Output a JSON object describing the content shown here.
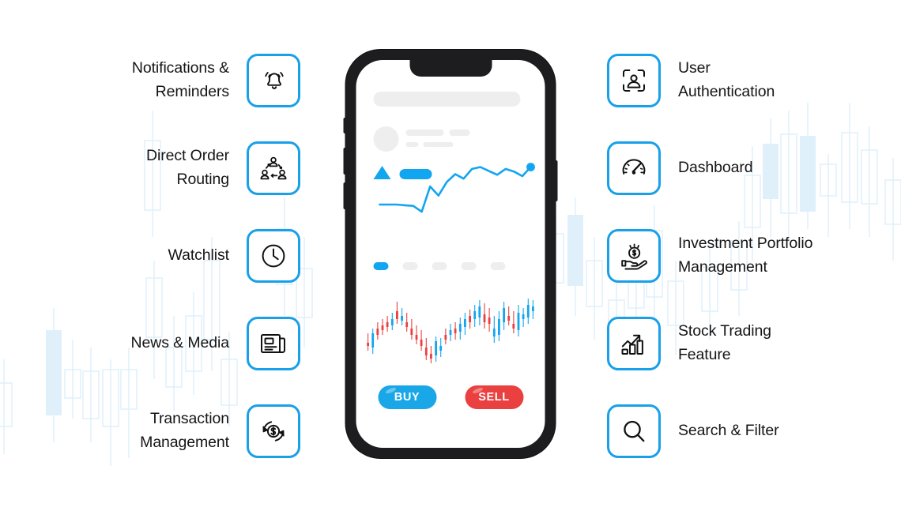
{
  "page": {
    "title": "Stock Trading App Features",
    "accent_color": "#18a0e8",
    "phone_accent": "#12a5f0",
    "buy_color": "#1aa7e8",
    "sell_color": "#ea4040",
    "background_color": "#ffffff",
    "watermark_color": "#dff0fb"
  },
  "features_left": [
    {
      "label": "Notifications &\nReminders",
      "icon": "bell-icon"
    },
    {
      "label": "Direct Order\nRouting",
      "icon": "order-routing-icon"
    },
    {
      "label": "Watchlist",
      "icon": "clock-icon"
    },
    {
      "label": "News & Media",
      "icon": "newspaper-icon"
    },
    {
      "label": "Transaction\nManagement",
      "icon": "transaction-refresh-dollar-icon"
    }
  ],
  "features_right": [
    {
      "label": "User\nAuthentication",
      "icon": "face-authentication-icon"
    },
    {
      "label": "Dashboard",
      "icon": "speedometer-icon"
    },
    {
      "label": "Investment Portfolio\nManagement",
      "icon": "hand-holding-dollar-icon"
    },
    {
      "label": "Stock Trading\nFeature",
      "icon": "bar-chart-arrow-up-icon"
    },
    {
      "label": "Search & Filter",
      "icon": "magnifier-icon"
    }
  ],
  "phone": {
    "buy_label": "BUY",
    "sell_label": "SELL",
    "pagination_dots": 5,
    "active_dot_index": 0
  },
  "chart_data": [
    {
      "type": "line",
      "title": "",
      "xlabel": "",
      "ylabel": "",
      "x": [
        0,
        1,
        2,
        3,
        4,
        5,
        6,
        7,
        8,
        9,
        10,
        11,
        12,
        13,
        14,
        15,
        16,
        17,
        18
      ],
      "values": [
        28,
        28,
        28,
        27,
        26,
        17,
        56,
        42,
        63,
        75,
        68,
        83,
        86,
        80,
        74,
        83,
        79,
        72,
        86
      ],
      "ylim": [
        0,
        100
      ],
      "grid": false,
      "series_color": "#12a5f0",
      "end_marker": true
    },
    {
      "type": "candlestick",
      "title": "",
      "xlabel": "",
      "ylabel": "",
      "grid": false,
      "up_color": "#12a5f0",
      "down_color": "#ea4040",
      "candles": [
        {
          "o": 40,
          "h": 52,
          "l": 30,
          "c": 36,
          "dir": "down"
        },
        {
          "o": 34,
          "h": 58,
          "l": 26,
          "c": 52,
          "dir": "up"
        },
        {
          "o": 50,
          "h": 66,
          "l": 44,
          "c": 58,
          "dir": "down"
        },
        {
          "o": 56,
          "h": 70,
          "l": 50,
          "c": 62,
          "dir": "down"
        },
        {
          "o": 60,
          "h": 74,
          "l": 54,
          "c": 66,
          "dir": "down"
        },
        {
          "o": 62,
          "h": 78,
          "l": 56,
          "c": 70,
          "dir": "up"
        },
        {
          "o": 70,
          "h": 92,
          "l": 64,
          "c": 80,
          "dir": "down"
        },
        {
          "o": 74,
          "h": 84,
          "l": 62,
          "c": 68,
          "dir": "up"
        },
        {
          "o": 66,
          "h": 78,
          "l": 54,
          "c": 60,
          "dir": "down"
        },
        {
          "o": 58,
          "h": 70,
          "l": 44,
          "c": 50,
          "dir": "down"
        },
        {
          "o": 50,
          "h": 62,
          "l": 38,
          "c": 44,
          "dir": "down"
        },
        {
          "o": 44,
          "h": 56,
          "l": 30,
          "c": 36,
          "dir": "down"
        },
        {
          "o": 34,
          "h": 46,
          "l": 18,
          "c": 24,
          "dir": "down"
        },
        {
          "o": 26,
          "h": 36,
          "l": 14,
          "c": 20,
          "dir": "down"
        },
        {
          "o": 24,
          "h": 48,
          "l": 16,
          "c": 42,
          "dir": "up"
        },
        {
          "o": 36,
          "h": 46,
          "l": 22,
          "c": 30,
          "dir": "up"
        },
        {
          "o": 44,
          "h": 58,
          "l": 38,
          "c": 50,
          "dir": "down"
        },
        {
          "o": 50,
          "h": 64,
          "l": 42,
          "c": 56,
          "dir": "up"
        },
        {
          "o": 52,
          "h": 66,
          "l": 44,
          "c": 58,
          "dir": "down"
        },
        {
          "o": 54,
          "h": 72,
          "l": 44,
          "c": 64,
          "dir": "up"
        },
        {
          "o": 60,
          "h": 78,
          "l": 50,
          "c": 70,
          "dir": "up"
        },
        {
          "o": 66,
          "h": 82,
          "l": 58,
          "c": 74,
          "dir": "down"
        },
        {
          "o": 70,
          "h": 88,
          "l": 60,
          "c": 80,
          "dir": "up"
        },
        {
          "o": 72,
          "h": 94,
          "l": 62,
          "c": 86,
          "dir": "up"
        },
        {
          "o": 76,
          "h": 90,
          "l": 58,
          "c": 66,
          "dir": "down"
        },
        {
          "o": 64,
          "h": 84,
          "l": 54,
          "c": 72,
          "dir": "down"
        },
        {
          "o": 58,
          "h": 74,
          "l": 40,
          "c": 48,
          "dir": "up"
        },
        {
          "o": 50,
          "h": 80,
          "l": 42,
          "c": 70,
          "dir": "up"
        },
        {
          "o": 66,
          "h": 92,
          "l": 56,
          "c": 84,
          "dir": "up"
        },
        {
          "o": 74,
          "h": 86,
          "l": 62,
          "c": 68,
          "dir": "down"
        },
        {
          "o": 64,
          "h": 80,
          "l": 52,
          "c": 58,
          "dir": "down"
        },
        {
          "o": 56,
          "h": 88,
          "l": 48,
          "c": 78,
          "dir": "up"
        },
        {
          "o": 70,
          "h": 84,
          "l": 60,
          "c": 76,
          "dir": "up"
        },
        {
          "o": 72,
          "h": 96,
          "l": 64,
          "c": 88,
          "dir": "up"
        },
        {
          "o": 80,
          "h": 94,
          "l": 70,
          "c": 86,
          "dir": "up"
        }
      ]
    }
  ]
}
